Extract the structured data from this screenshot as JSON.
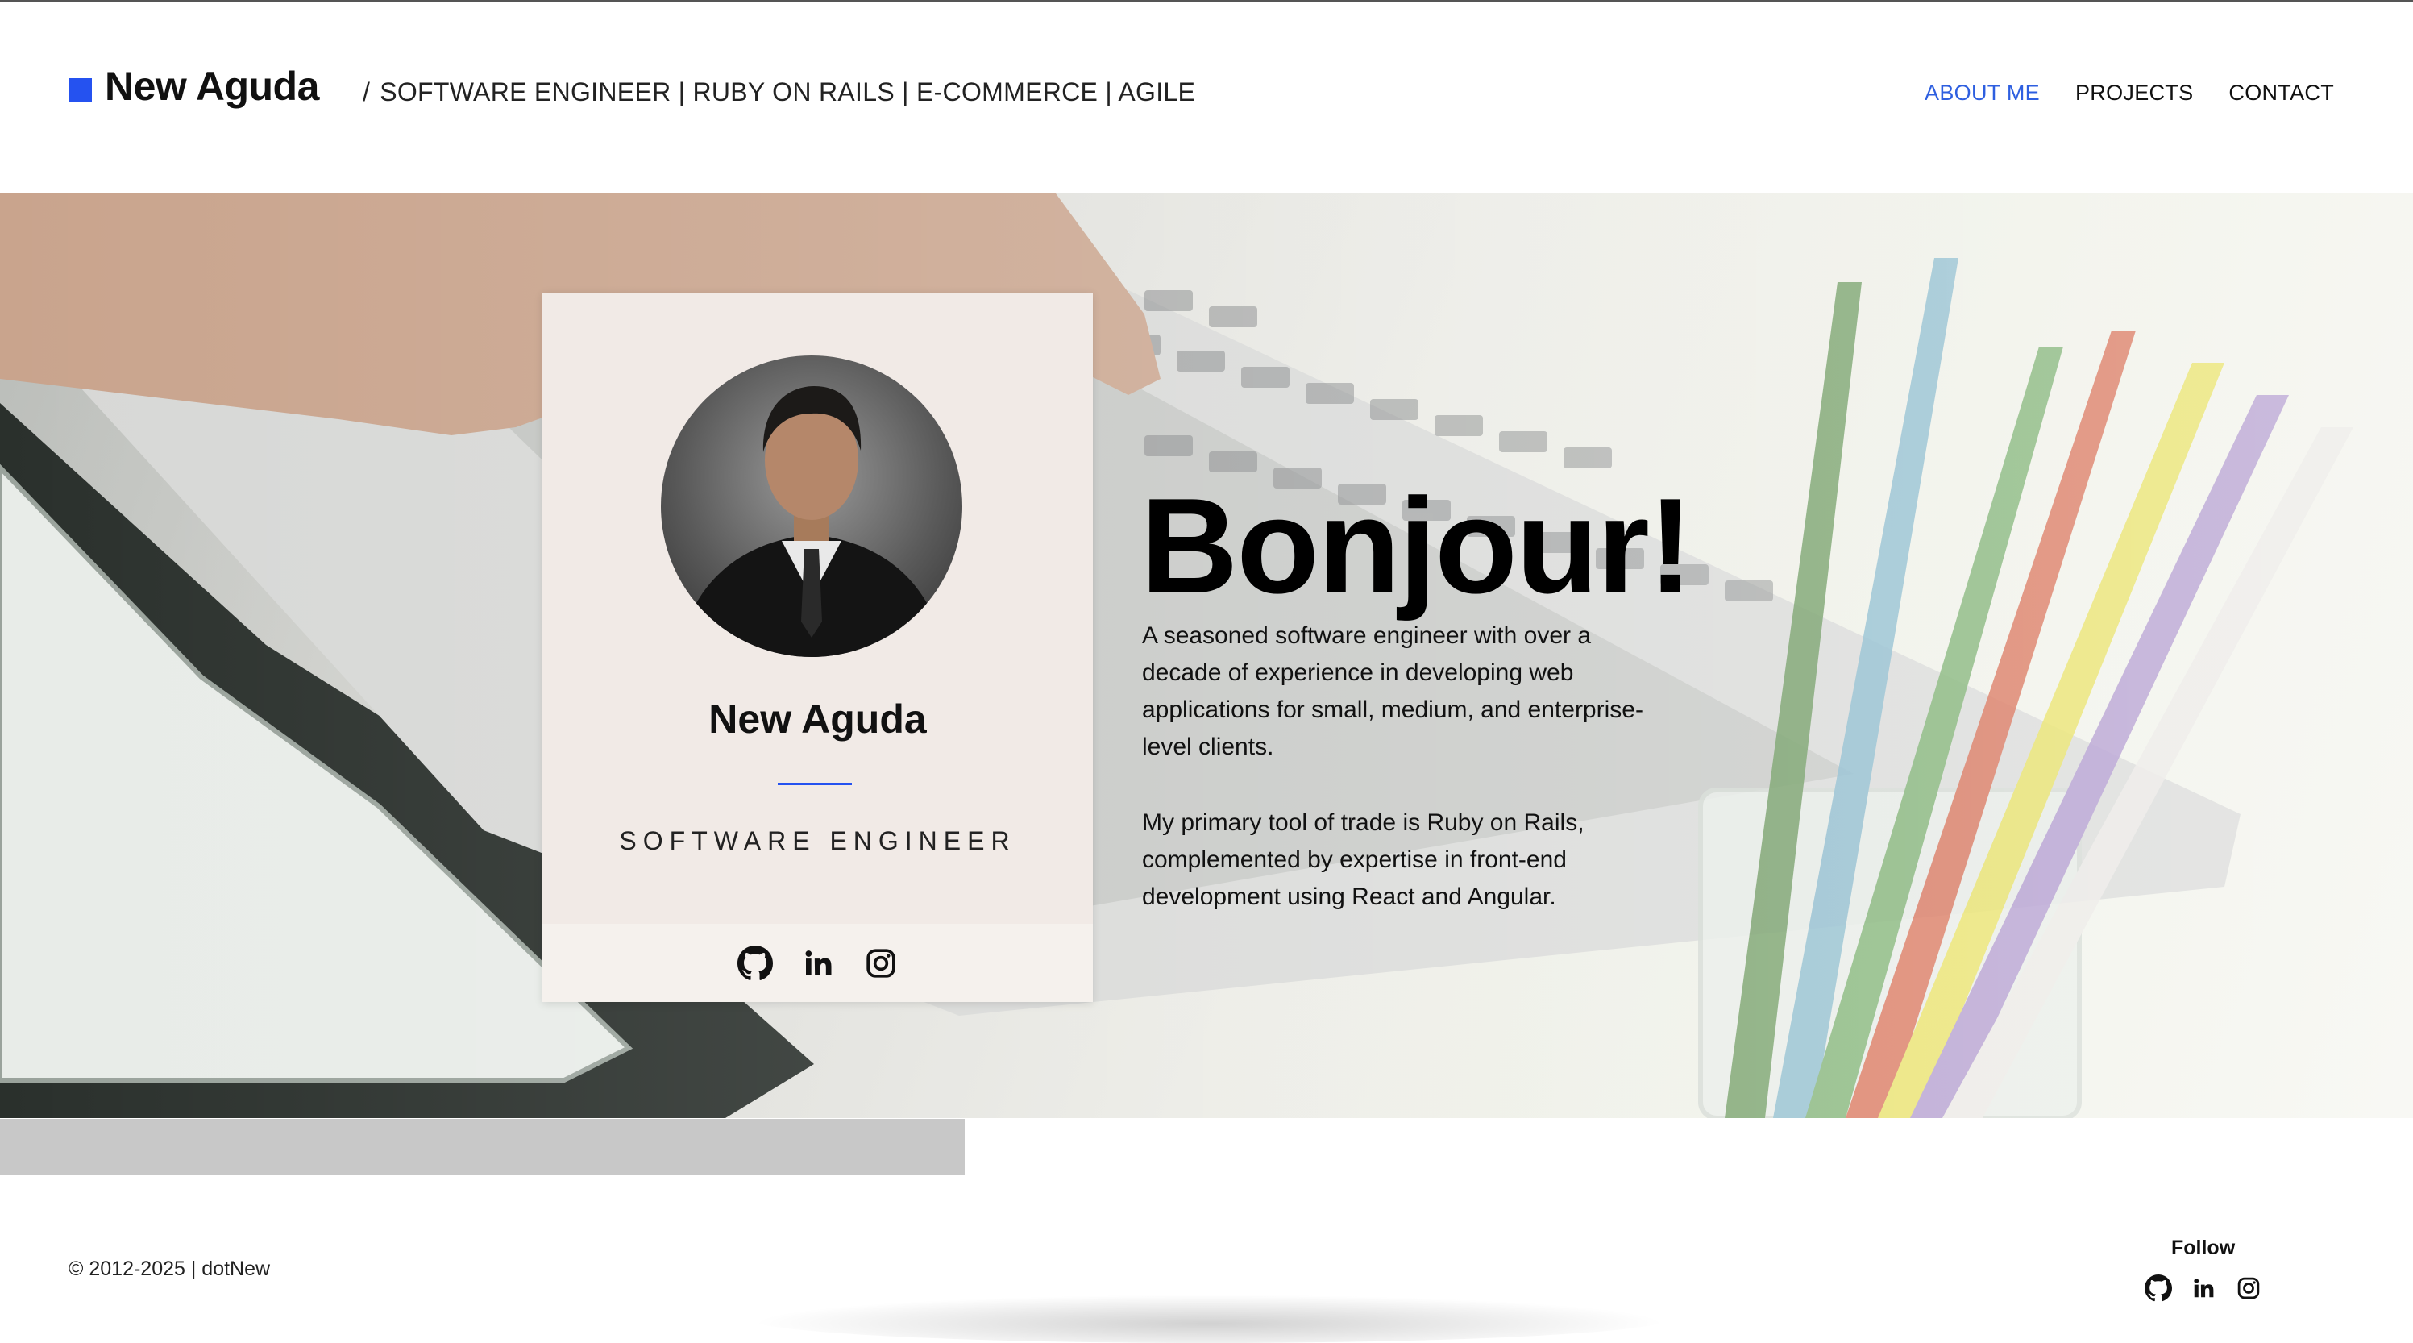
{
  "header": {
    "brand_name": "New Aguda",
    "tagline_slash": "/",
    "tagline": "SOFTWARE ENGINEER | RUBY ON RAILS | E-COMMERCE | AGILE",
    "nav": [
      {
        "label": "ABOUT ME",
        "active": true
      },
      {
        "label": "PROJECTS",
        "active": false
      },
      {
        "label": "CONTACT",
        "active": false
      }
    ]
  },
  "card": {
    "name": "New Aguda",
    "role": "SOFTWARE ENGINEER",
    "social_icons": [
      "github-icon",
      "linkedin-icon",
      "instagram-icon"
    ]
  },
  "hero": {
    "greeting": "Bonjour!",
    "bio_1": "A seasoned software engineer with over a decade of experience in developing web applications for small, medium, and enterprise-level clients.",
    "bio_2": "My primary tool of trade is Ruby on Rails, complemented by expertise in front-end development using React and Angular."
  },
  "footer": {
    "copyright": "© 2012-2025 | dotNew",
    "follow_label": "Follow",
    "social_icons": [
      "github-icon",
      "linkedin-icon",
      "instagram-icon"
    ]
  },
  "colors": {
    "accent": "#2552f0",
    "nav_active": "#2e5fe0",
    "card_bg": "#f1eae6"
  }
}
